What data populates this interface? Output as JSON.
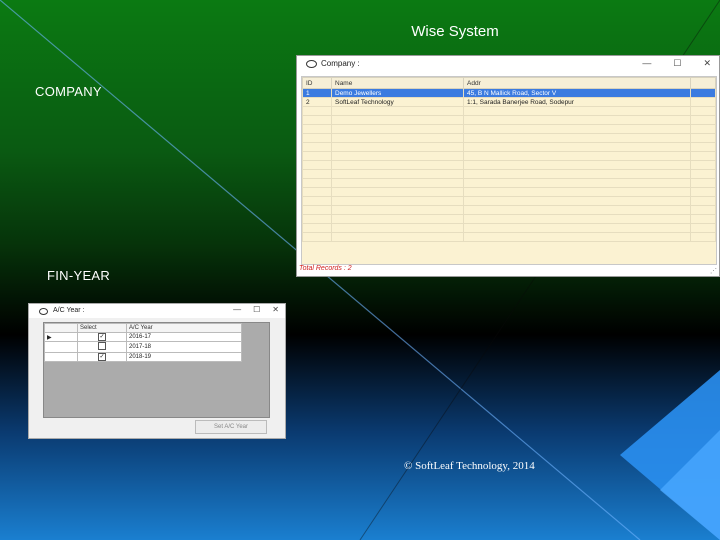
{
  "slide": {
    "title": "Wise System",
    "company_label": "COMPANY",
    "finyear_label": "FIN-YEAR",
    "footer": "© SoftLeaf  Technology, 2014",
    "colors": {
      "accent_blue": "#1a7fd0",
      "green": "#0b7a12",
      "status_red": "#d02020"
    }
  },
  "company_window": {
    "title": "Company :",
    "buttons": {
      "minimize": "—",
      "maximize": "☐",
      "close": "✕"
    },
    "columns": [
      "ID",
      "Name",
      "Addr"
    ],
    "rows": [
      {
        "id": "1",
        "name": "Demo Jewellers",
        "addr": "45, B N Mallick Road, Sector V",
        "selected": true
      },
      {
        "id": "2",
        "name": "SoftLeaf Technology",
        "addr": "1:1, Sarada Banerjee Road, Sodepur",
        "selected": false
      }
    ],
    "status": "Total Records : 2"
  },
  "year_window": {
    "title": "A/C Year :",
    "buttons": {
      "minimize": "—",
      "maximize": "☐",
      "close": "✕"
    },
    "columns": [
      "",
      "Select",
      "A/C Year"
    ],
    "rows": [
      {
        "marker": "▶",
        "checked": true,
        "year": "2016-17"
      },
      {
        "marker": "",
        "checked": false,
        "year": "2017-18"
      },
      {
        "marker": "",
        "checked": true,
        "year": "2018-19"
      }
    ],
    "set_button": "Set A/C Year"
  }
}
